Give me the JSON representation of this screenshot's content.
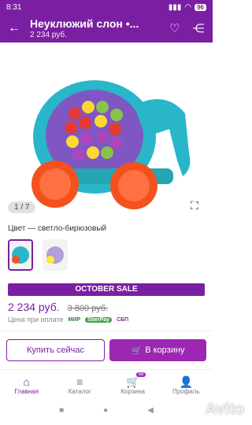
{
  "status": {
    "time": "8:31",
    "battery": "96"
  },
  "appbar": {
    "title": "Неуклюжий слон •...",
    "price": "2 234 руб."
  },
  "gallery": {
    "counter": "1 / 7"
  },
  "color_label": "Цвет — светло-бирюзовый",
  "sale_banner": "OCTOBER SALE",
  "price": {
    "current": "2 234 руб.",
    "old": "3 800 руб."
  },
  "payment": {
    "label": "Цена при оплате",
    "methods": [
      "МИР",
      "SberPay",
      "СБП"
    ]
  },
  "buttons": {
    "buy_now": "Купить сейчас",
    "add_to_cart": "В корзину"
  },
  "tabs": [
    {
      "label": "Главная"
    },
    {
      "label": "Каталог"
    },
    {
      "label": "Корзина",
      "badge": "68"
    },
    {
      "label": "Профиль"
    }
  ],
  "watermark": "Avito",
  "colors": {
    "brand": "#7b1fa2",
    "button": "#9c27b0"
  }
}
